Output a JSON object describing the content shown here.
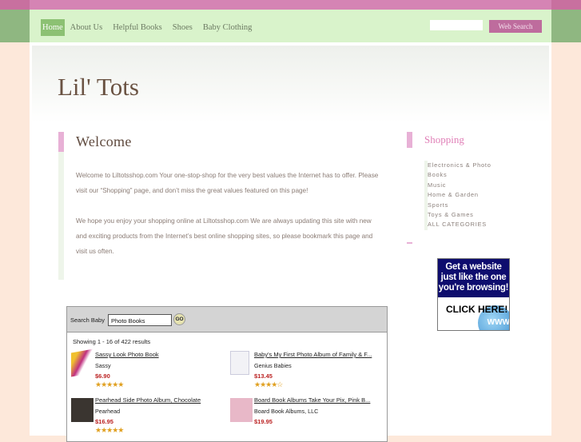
{
  "nav": {
    "items": [
      "Home",
      "About Us",
      "Helpful Books",
      "Shoes",
      "Baby Clothing"
    ],
    "search_button": "Web Search"
  },
  "site_title": "Lil' Tots",
  "welcome": {
    "heading": "Welcome",
    "p1": "Welcome to Liltotsshop.com Your one-stop-shop for the very best values the Internet has to offer. Please visit our “Shopping” page, and don’t miss the great values featured on this page!",
    "p2": "We hope you enjoy your shopping online at Liltotsshop.com We are always updating this site with new and exciting products from the Internet’s best online shopping sites, so please bookmark this page and visit us often."
  },
  "sidebar": {
    "heading": "Shopping",
    "categories": [
      "Electronics & Photo",
      "Books",
      "Music",
      "Home & Garden",
      "Sports",
      "Toys & Games",
      "ALL CATEGORIES"
    ]
  },
  "ad": {
    "headline": "Get a website just like the one you're browsing!",
    "cta": "CLICK HERE!",
    "globe": "WWW"
  },
  "widget": {
    "search_label": "Search Baby",
    "search_value": "Photo Books",
    "go": "GO",
    "count": "Showing 1 - 16 of 422 results",
    "products": [
      {
        "name": "Sassy Look Photo Book",
        "brand": "Sassy",
        "price": "$6.90",
        "stars": "★★★★★",
        "rating": 4.5
      },
      {
        "name": "Baby's My First Photo Album of Family & F...",
        "brand": "Genius Babies",
        "price": "$13.45",
        "stars": "★★★★☆",
        "rating": 4
      },
      {
        "name": "Pearhead Side Photo Album, Chocolate",
        "brand": "Pearhead",
        "price": "$16.95",
        "stars": "★★★★★",
        "rating": 4.5
      },
      {
        "name": "Board Book Albums Take Your Pix, Pink B...",
        "brand": "Board Book Albums, LLC",
        "price": "$19.95",
        "stars": "",
        "rating": null
      }
    ]
  }
}
